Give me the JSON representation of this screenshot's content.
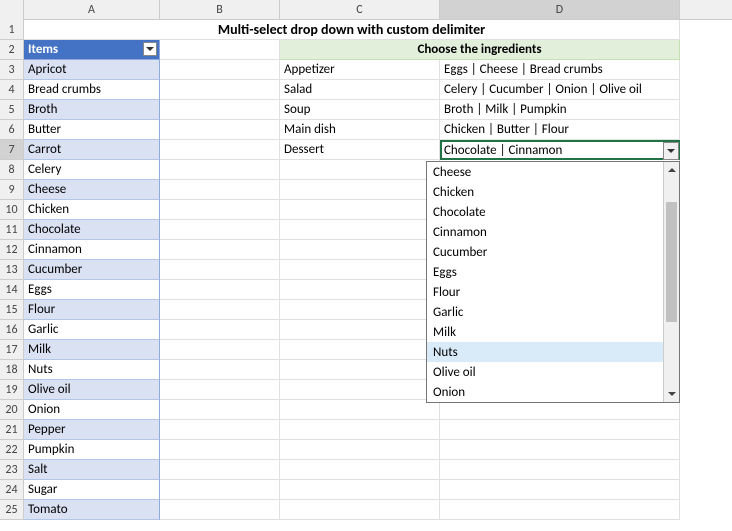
{
  "title": "Multi-select drop down with custom delimiter",
  "columns": [
    "A",
    "B",
    "C",
    "D"
  ],
  "row_count": 25,
  "items_header": "Items",
  "ingredients_header": "Choose the ingredients",
  "items": [
    "Apricot",
    "Bread crumbs",
    "Broth",
    "Butter",
    "Carrot",
    "Celery",
    "Cheese",
    "Chicken",
    "Chocolate",
    "Cinnamon",
    "Cucumber",
    "Eggs",
    "Flour",
    "Garlic",
    "Milk",
    "Nuts",
    "Olive oil",
    "Onion",
    "Pepper",
    "Pumpkin",
    "Salt",
    "Sugar",
    "Tomato"
  ],
  "dishes": [
    {
      "name": "Appetizer",
      "ingredients": "Eggs | Cheese | Bread crumbs"
    },
    {
      "name": "Salad",
      "ingredients": "Celery | Cucumber | Onion | Olive oil"
    },
    {
      "name": "Soup",
      "ingredients": "Broth | Milk | Pumpkin"
    },
    {
      "name": "Main dish",
      "ingredients": "Chicken | Butter | Flour"
    },
    {
      "name": "Dessert",
      "ingredients": "Chocolate | Cinnamon"
    }
  ],
  "selected_cell": "D7",
  "dropdown_options": [
    "Cheese",
    "Chicken",
    "Chocolate",
    "Cinnamon",
    "Cucumber",
    "Eggs",
    "Flour",
    "Garlic",
    "Milk",
    "Nuts",
    "Olive oil",
    "Onion"
  ],
  "dropdown_hover": "Nuts"
}
